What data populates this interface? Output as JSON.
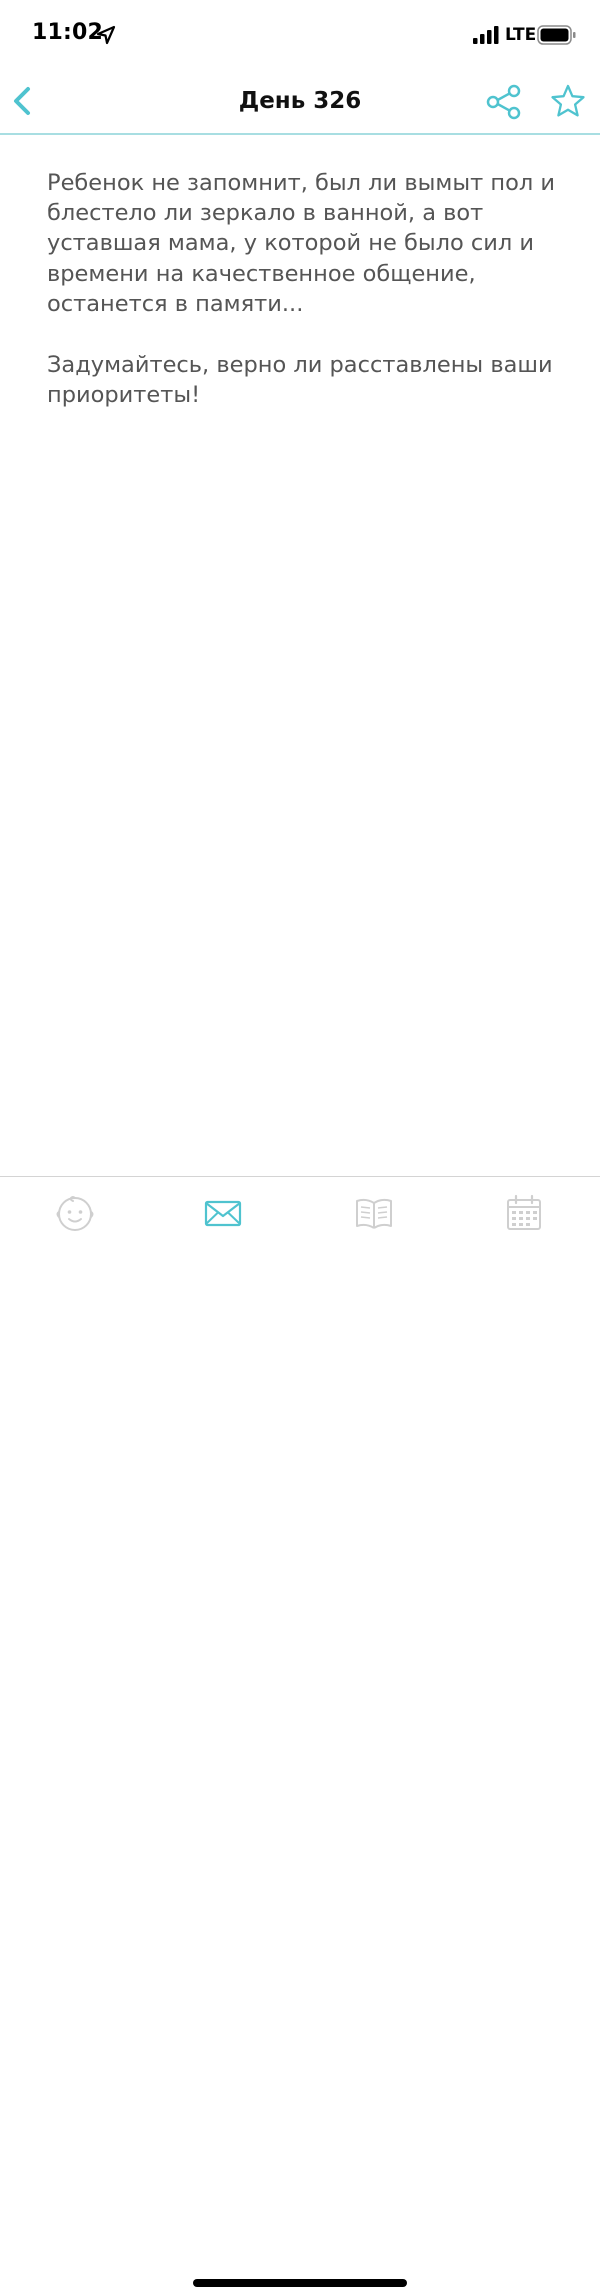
{
  "status_bar": {
    "time": "11:02",
    "network": "LTE",
    "icons": [
      "location-arrow-icon",
      "signal-bars-icon",
      "battery-icon"
    ]
  },
  "nav": {
    "title": "День 326",
    "icons": [
      "chevron-left-icon",
      "share-icon",
      "star-icon"
    ],
    "accent_color": "#4fc3cf"
  },
  "content": {
    "paragraphs": [
      "Ребенок не запомнит, был ли вымыт пол и блестело ли зеркало в ванной, а вот уставшая мама, у которой не было сил и времени на качественное общение, останется в памяти...",
      "Задумайтесь, верно ли расставлены ваши приоритеты!"
    ],
    "text_color": "#555555"
  },
  "tab_bar": {
    "tabs": [
      {
        "icon": "baby-face-icon",
        "active": false
      },
      {
        "icon": "envelope-icon",
        "active": true
      },
      {
        "icon": "open-book-icon",
        "active": false
      },
      {
        "icon": "calendar-icon",
        "active": false
      }
    ],
    "active_color": "#4fc3cf",
    "inactive_color": "#cfcfcf"
  }
}
